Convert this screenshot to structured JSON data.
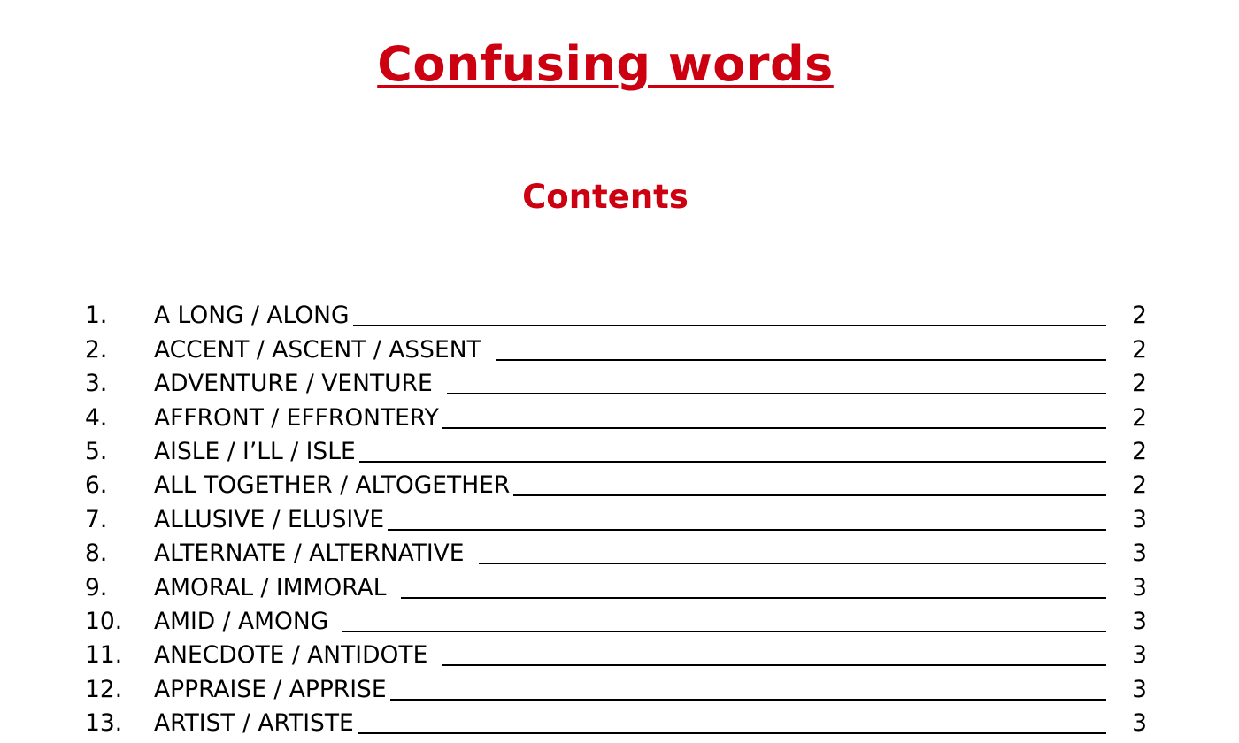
{
  "document": {
    "title": "Confusing words",
    "contents_heading": "Contents",
    "accent_color": "#cc0010",
    "text_color": "#000000"
  },
  "toc": {
    "entries": [
      {
        "number": "1.",
        "label": "A LONG / ALONG",
        "page": "2"
      },
      {
        "number": "2.",
        "label": "ACCENT / ASCENT / ASSENT",
        "page": "2"
      },
      {
        "number": "3.",
        "label": "ADVENTURE / VENTURE",
        "page": "2"
      },
      {
        "number": "4.",
        "label": "AFFRONT / EFFRONTERY",
        "page": "2"
      },
      {
        "number": "5.",
        "label": "AISLE / I’LL / ISLE",
        "page": "2"
      },
      {
        "number": "6.",
        "label": "ALL TOGETHER / ALTOGETHER",
        "page": "2"
      },
      {
        "number": "7.",
        "label": "ALLUSIVE / ELUSIVE",
        "page": "3"
      },
      {
        "number": "8.",
        "label": "ALTERNATE / ALTERNATIVE",
        "page": "3"
      },
      {
        "number": "9.",
        "label": "AMORAL / IMMORAL",
        "page": "3"
      },
      {
        "number": "10.",
        "label": "AMID / AMONG",
        "page": "3"
      },
      {
        "number": "11.",
        "label": "ANECDOTE / ANTIDOTE",
        "page": "3"
      },
      {
        "number": "12.",
        "label": "APPRAISE / APPRISE",
        "page": "3"
      },
      {
        "number": "13.",
        "label": "ARTIST / ARTISTE",
        "page": "3"
      }
    ]
  }
}
